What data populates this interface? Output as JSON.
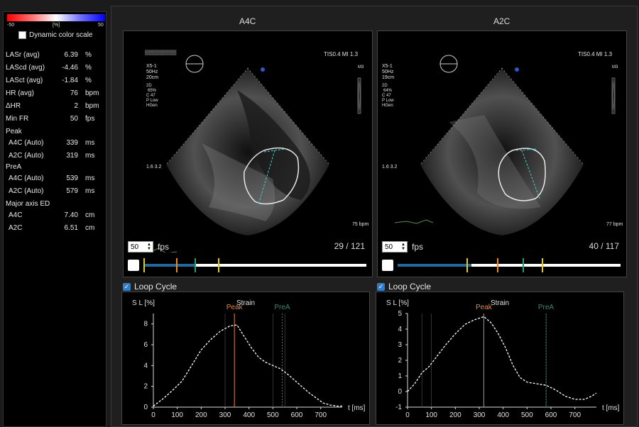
{
  "colorbar": {
    "min": "-50",
    "mid": "[%]",
    "max": "50"
  },
  "dynamic_color_scale": {
    "label": "Dynamic color scale",
    "checked": false
  },
  "metrics": [
    {
      "name": "LASr (avg)",
      "value": "6.39",
      "unit": "%"
    },
    {
      "name": "LAScd (avg)",
      "value": "-4.46",
      "unit": "%"
    },
    {
      "name": "LASct (avg)",
      "value": "-1.84",
      "unit": "%"
    },
    {
      "name": "HR (avg)",
      "value": "76",
      "unit": "bpm"
    },
    {
      "name": "ΔHR",
      "value": "2",
      "unit": "bpm"
    },
    {
      "name": "Min FR",
      "value": "50",
      "unit": "fps"
    },
    {
      "name": "Peak",
      "value": "",
      "unit": ""
    },
    {
      "name": "A4C (Auto)",
      "value": "339",
      "unit": "ms"
    },
    {
      "name": "A2C (Auto)",
      "value": "319",
      "unit": "ms"
    },
    {
      "name": "PreA",
      "value": "",
      "unit": ""
    },
    {
      "name": "A4C (Auto)",
      "value": "539",
      "unit": "ms"
    },
    {
      "name": "A2C (Auto)",
      "value": "579",
      "unit": "ms"
    },
    {
      "name": "Major axis ED",
      "value": "",
      "unit": ""
    },
    {
      "name": "A4C",
      "value": "7.40",
      "unit": "cm"
    },
    {
      "name": "A2C",
      "value": "6.51",
      "unit": "cm"
    }
  ],
  "views": [
    {
      "title": "A4C",
      "overlay": {
        "header": "TIS0.4  MI 1.3",
        "probe": "X5-1",
        "freq": "50Hz",
        "depth": "20cm",
        "mode": "2D",
        "gain": "65%",
        "c": "C 47",
        "p": "P Low",
        "gen": "HGen",
        "m3": "M3",
        "bpm": "75 bpm",
        "scale": "1.6  3.2"
      },
      "fps_value": "50",
      "fps_label": "fps",
      "frame": "29 / 121",
      "progress": 0.23,
      "markers": [
        {
          "pos": 0.0,
          "color": "#e8d000"
        },
        {
          "pos": 0.145,
          "color": "#f08a20"
        },
        {
          "pos": 0.23,
          "color": "#1aa07a"
        },
        {
          "pos": 0.335,
          "color": "#e8d000"
        }
      ],
      "loop_label": "Loop Cycle"
    },
    {
      "title": "A2C",
      "overlay": {
        "header": "TIS0.4  MI 1.3",
        "probe": "X5-1",
        "freq": "50Hz",
        "depth": "19cm",
        "mode": "2D",
        "gain": "64%",
        "c": "C 47",
        "p": "P Low",
        "gen": "HGen",
        "m3": "M3",
        "bpm": "77 bpm",
        "scale": "1.6  3.2"
      },
      "fps_value": "50",
      "fps_label": "fps",
      "frame": "40 / 117",
      "progress": 0.33,
      "markers": [
        {
          "pos": 0.31,
          "color": "#e8d000"
        },
        {
          "pos": 0.445,
          "color": "#f08a20"
        },
        {
          "pos": 0.56,
          "color": "#1aa07a"
        },
        {
          "pos": 0.645,
          "color": "#e8d000"
        }
      ],
      "loop_label": "Loop Cycle"
    }
  ],
  "chart_data": [
    {
      "type": "line",
      "title": "Strain",
      "ylabel": "S L [%]",
      "xlabel": "t [ms]",
      "xlim": [
        0,
        790
      ],
      "ylim": [
        0,
        9
      ],
      "xticks": [
        0,
        100,
        200,
        300,
        400,
        500,
        600,
        700
      ],
      "yticks": [
        0,
        2,
        4,
        6,
        8
      ],
      "peak": {
        "label": "Peak",
        "x": 339,
        "color": "#e8873a"
      },
      "prea": {
        "label": "PreA",
        "x": 539,
        "color": "#2f8f6a"
      },
      "gridlines_x": [
        300,
        500,
        550
      ],
      "series": [
        {
          "points": [
            [
              0,
              0.1
            ],
            [
              40,
              0.8
            ],
            [
              80,
              1.6
            ],
            [
              120,
              2.5
            ],
            [
              160,
              4.0
            ],
            [
              200,
              5.5
            ],
            [
              240,
              6.5
            ],
            [
              280,
              7.3
            ],
            [
              320,
              7.8
            ],
            [
              350,
              7.9
            ],
            [
              380,
              6.8
            ],
            [
              410,
              5.7
            ],
            [
              440,
              4.8
            ],
            [
              470,
              4.3
            ],
            [
              500,
              4.0
            ],
            [
              530,
              3.7
            ],
            [
              560,
              3.2
            ],
            [
              590,
              2.6
            ],
            [
              620,
              2.0
            ],
            [
              650,
              1.4
            ],
            [
              680,
              0.9
            ],
            [
              710,
              0.4
            ],
            [
              740,
              0.2
            ],
            [
              770,
              0.1
            ],
            [
              790,
              0.1
            ]
          ]
        }
      ]
    },
    {
      "type": "line",
      "title": "Strain",
      "ylabel": "S L [%]",
      "xlabel": "t [ms]",
      "xlim": [
        0,
        790
      ],
      "ylim": [
        -1,
        5
      ],
      "xticks": [
        0,
        100,
        200,
        300,
        400,
        500,
        600,
        700
      ],
      "yticks": [
        -1,
        0,
        1,
        2,
        3,
        4,
        5
      ],
      "peak": {
        "label": "Peak",
        "x": 319,
        "color": "#e8873a"
      },
      "prea": {
        "label": "PreA",
        "x": 579,
        "color": "#2f8f6a"
      },
      "gridlines_x": [
        60,
        100,
        580
      ],
      "series": [
        {
          "points": [
            [
              0,
              0.0
            ],
            [
              30,
              0.5
            ],
            [
              60,
              1.2
            ],
            [
              90,
              1.6
            ],
            [
              120,
              2.2
            ],
            [
              160,
              3.0
            ],
            [
              200,
              3.7
            ],
            [
              240,
              4.3
            ],
            [
              280,
              4.6
            ],
            [
              320,
              4.8
            ],
            [
              350,
              4.4
            ],
            [
              380,
              3.7
            ],
            [
              410,
              2.8
            ],
            [
              440,
              1.7
            ],
            [
              470,
              0.9
            ],
            [
              500,
              0.6
            ],
            [
              540,
              0.5
            ],
            [
              580,
              0.4
            ],
            [
              620,
              0.1
            ],
            [
              660,
              -0.3
            ],
            [
              700,
              -0.5
            ],
            [
              740,
              -0.5
            ],
            [
              770,
              -0.3
            ],
            [
              790,
              -0.1
            ]
          ]
        }
      ]
    }
  ]
}
